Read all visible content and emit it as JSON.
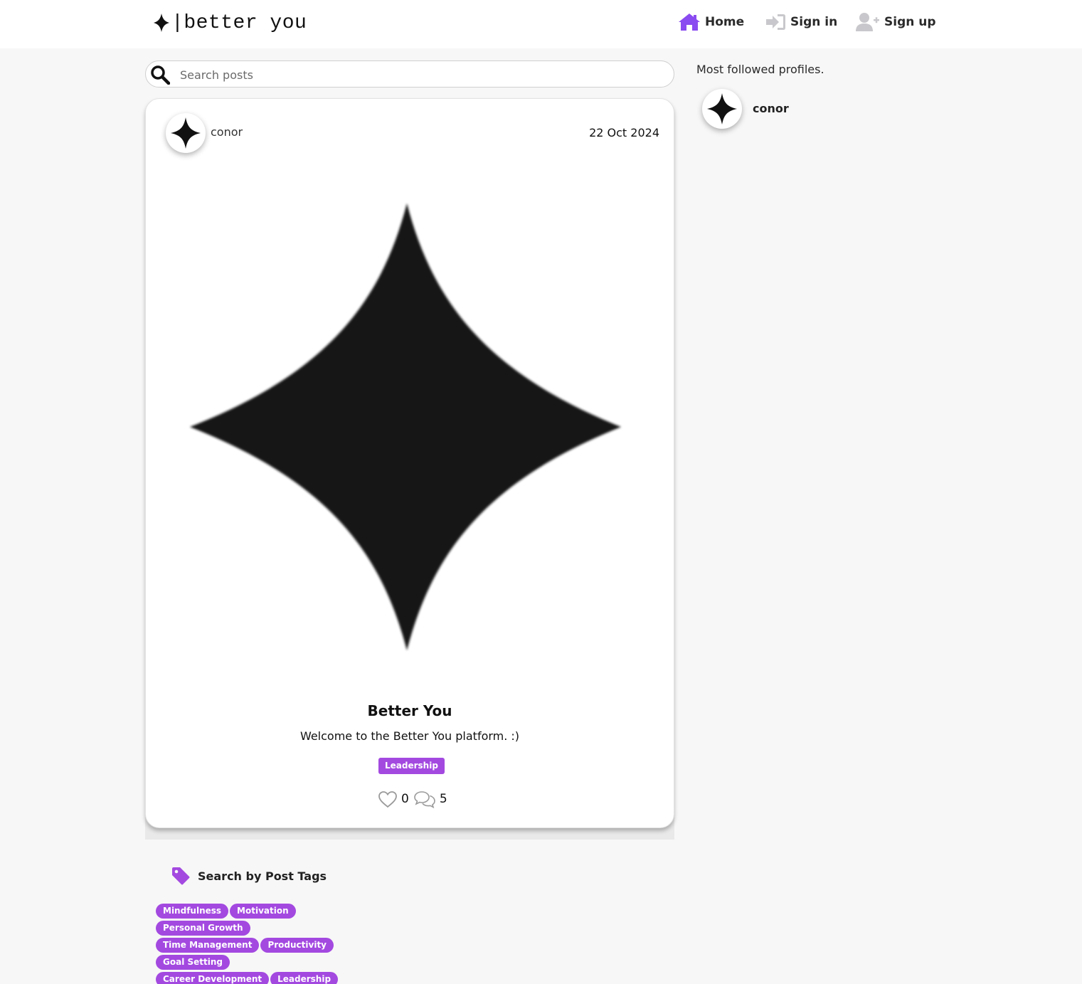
{
  "header": {
    "logo_text": "better you",
    "nav": {
      "home": "Home",
      "signin": "Sign in",
      "signup": "Sign up"
    }
  },
  "search": {
    "placeholder": "Search posts"
  },
  "post": {
    "author": "conor",
    "date": "22 Oct 2024",
    "title": "Better You",
    "body": "Welcome to the Better You platform. :)",
    "tag": "Leadership",
    "likes": "0",
    "comments": "5"
  },
  "sidebar": {
    "title": "Most followed profiles.",
    "profiles": [
      {
        "name": "conor"
      }
    ]
  },
  "tags_section": {
    "title": "Search by Post Tags",
    "rows": [
      [
        "Mindfulness",
        "Motivation"
      ],
      [
        "Personal Growth"
      ],
      [
        "Time Management",
        "Productivity"
      ],
      [
        "Goal Setting"
      ],
      [
        "Career Development",
        "Leadership"
      ]
    ]
  },
  "colors": {
    "accent": "#a349e0",
    "home_icon": "#8a4bf0",
    "inactive_icon": "#c8c8cc"
  },
  "icons": {
    "logo": "sparkle-icon",
    "home": "home-icon",
    "signin": "sign-in-icon",
    "signup": "user-plus-icon",
    "search": "search-icon",
    "like": "heart-icon",
    "comment": "comments-icon",
    "tag": "tag-icon"
  }
}
